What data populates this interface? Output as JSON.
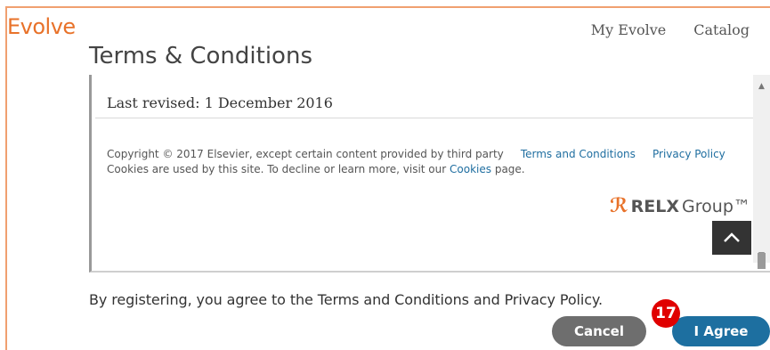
{
  "app": {
    "logo": "Evolve"
  },
  "nav": {
    "items": [
      "My Evolve",
      "Catalog"
    ]
  },
  "page": {
    "title": "Terms & Conditions"
  },
  "terms": {
    "last_revised_label": "Last revised:",
    "last_revised_date": "1 December 2016",
    "copyright_text": "Copyright © 2017 Elsevier, except certain content provided by third party",
    "terms_link": "Terms and Conditions",
    "privacy_link": "Privacy Policy",
    "cookies_prefix": "Cookies are used by this site. To decline or learn more, visit our",
    "cookies_link": "Cookies",
    "cookies_suffix": "page.",
    "relx_bold": "RELX",
    "relx_rest": "Group™",
    "back_to_top": "^"
  },
  "footer": {
    "agreement_text": "By registering, you agree to the Terms and Conditions and Privacy Policy.",
    "cancel_label": "Cancel",
    "agree_label": "I Agree",
    "step_badge": "17"
  },
  "colors": {
    "brand_orange": "#e8722a",
    "link_blue": "#1f6ea0",
    "agree_button": "#1d6fa0",
    "cancel_button": "#6e6e6e",
    "badge_red": "#e00000"
  }
}
